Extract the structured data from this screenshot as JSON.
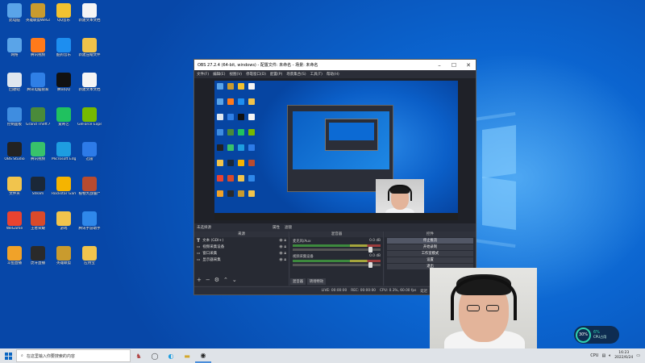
{
  "desktop": {
    "icons": [
      {
        "label": "此电脑",
        "color": "#5aa4e8"
      },
      {
        "label": "英雄联盟WeGame版",
        "color": "#c99b2e"
      },
      {
        "label": "QQ音乐",
        "color": "#f2c230"
      },
      {
        "label": "新建文本文档",
        "color": "#f5f5f5"
      },
      {
        "label": "网络",
        "color": "#5aa4e8"
      },
      {
        "label": "腾讯视频",
        "color": "#ff7a1a"
      },
      {
        "label": "酷狗音乐",
        "color": "#1d8ef0"
      },
      {
        "label": "新建压缩文件",
        "color": "#f0c24a"
      },
      {
        "label": "回收站",
        "color": "#dfe7ef"
      },
      {
        "label": "腾讯电脑管家",
        "color": "#2f7fe6"
      },
      {
        "label": "腾讯QQ",
        "color": "#111111"
      },
      {
        "label": "新建文本文档",
        "color": "#f5f5f5"
      },
      {
        "label": "控制面板",
        "color": "#3f8de0"
      },
      {
        "label": "Grand Theft Auto V",
        "color": "#4a8a3a"
      },
      {
        "label": "爱奇艺",
        "color": "#20c15f"
      },
      {
        "label": "GeForce Experience",
        "color": "#76b900"
      },
      {
        "label": "OBS Studio",
        "color": "#222222"
      },
      {
        "label": "腾讯视频",
        "color": "#38c26b"
      },
      {
        "label": "Microsoft Edge",
        "color": "#1e9de0"
      },
      {
        "label": "迅雷",
        "color": "#2d7be8"
      },
      {
        "label": "文件夹",
        "color": "#f1c44d"
      },
      {
        "label": "Steam",
        "color": "#1b2838"
      },
      {
        "label": "Rockstar Games",
        "color": "#f5b400"
      },
      {
        "label": "植物大战僵尸",
        "color": "#b84b2f"
      },
      {
        "label": "WeGame",
        "color": "#e94330"
      },
      {
        "label": "王者荣耀",
        "color": "#d94a2a"
      },
      {
        "label": "游戏",
        "color": "#f1c44d"
      },
      {
        "label": "腾讯手游助手",
        "color": "#2f88ea"
      },
      {
        "label": "斗鱼直播",
        "color": "#f0a229"
      },
      {
        "label": "虎牙直播",
        "color": "#2a2a2a"
      },
      {
        "label": "英雄联盟",
        "color": "#c99b2e"
      },
      {
        "label": "应用宝",
        "color": "#f1c44d"
      }
    ]
  },
  "obs": {
    "title": "OBS 27.2.4 (64-bit, windows) - 配置文件: 未命名 - 场景: 未命名",
    "menu": [
      "文件(F)",
      "编辑(E)",
      "视图(V)",
      "停靠窗口(D)",
      "配置(P)",
      "场景集合(S)",
      "工具(T)",
      "帮助(H)"
    ],
    "scene_bar": [
      "未选择源",
      "属性",
      "滤镜"
    ],
    "sources": {
      "header": "来源",
      "items": [
        {
          "label": "文本 (GDI+)",
          "icon": "T"
        },
        {
          "label": "视频采集设备",
          "icon": "▭"
        },
        {
          "label": "窗口采集",
          "icon": "▭"
        },
        {
          "label": "显示器采集",
          "icon": "▭"
        }
      ]
    },
    "mixer": {
      "header": "混音器",
      "channels": [
        {
          "name": "麦克风/Aux",
          "level": "0.0 dB"
        },
        {
          "name": "视频采集设备",
          "level": "0.0 dB"
        }
      ],
      "tabs": [
        "混音器",
        "转场特效"
      ]
    },
    "controls": {
      "header": "控件",
      "buttons": [
        "停止推流",
        "开始录制",
        "工作室模式",
        "设置",
        "退出"
      ]
    },
    "status": {
      "live": "LIVE: 00:00:00",
      "rec": "REC: 00:00:00",
      "cpu": "CPU: 0.3%, 60.00 fps",
      "extra": "延迟"
    }
  },
  "perf": {
    "percent": "30%",
    "value": "6%",
    "label": "CPU占用"
  },
  "taskbar": {
    "search_placeholder": "在这里输入你要搜索的内容",
    "time": "16:23",
    "date": "2022/6/24",
    "tray_text": "CPU"
  }
}
